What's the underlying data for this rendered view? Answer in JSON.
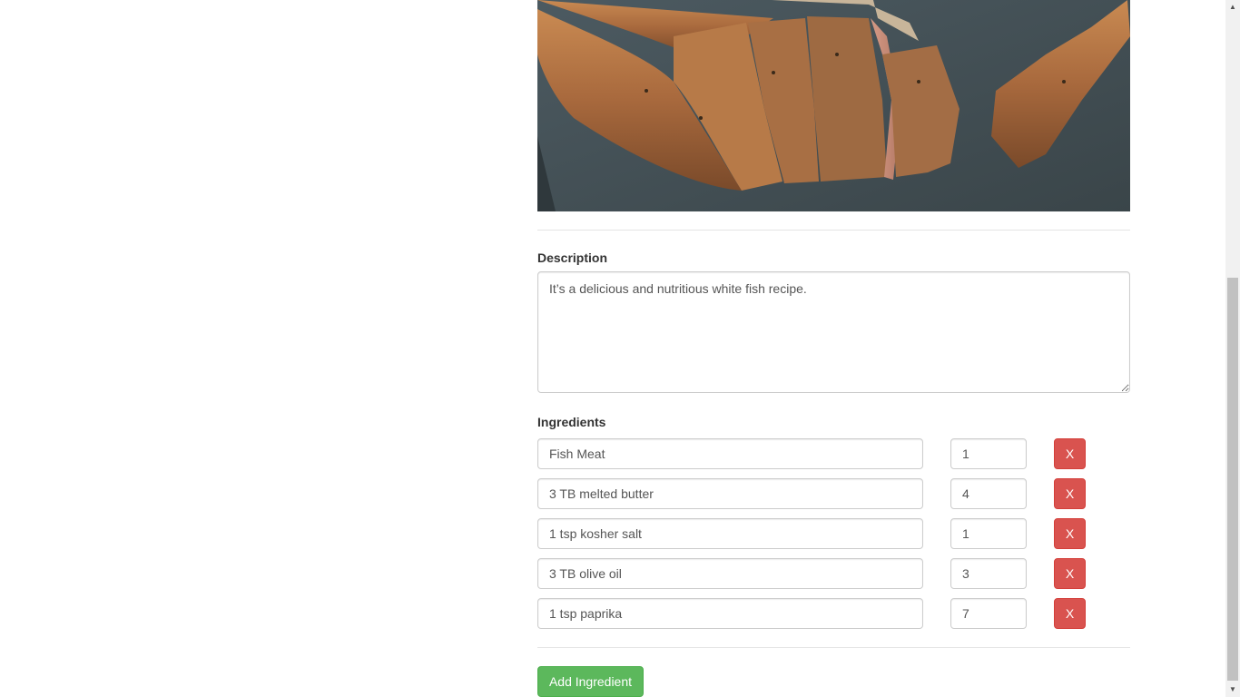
{
  "recipe_form": {
    "description_label": "Description",
    "description_value": "It’s a delicious and nutritious white fish recipe.",
    "ingredients_label": "Ingredients",
    "ingredients": [
      {
        "name": "Fish Meat",
        "quantity": "1",
        "remove_label": "X"
      },
      {
        "name": "3 TB melted butter",
        "quantity": "4",
        "remove_label": "X"
      },
      {
        "name": "1 tsp kosher salt",
        "quantity": "1",
        "remove_label": "X"
      },
      {
        "name": "3 TB olive oil",
        "quantity": "3",
        "remove_label": "X"
      },
      {
        "name": "1 tsp paprika",
        "quantity": "7",
        "remove_label": "X"
      }
    ],
    "add_button_label": "Add Ingredient"
  },
  "colors": {
    "danger": "#d9534f",
    "success": "#5cb85c",
    "border": "#cccccc"
  },
  "icons": {
    "scroll_up": "up-arrow-icon",
    "scroll_down": "down-arrow-icon"
  }
}
